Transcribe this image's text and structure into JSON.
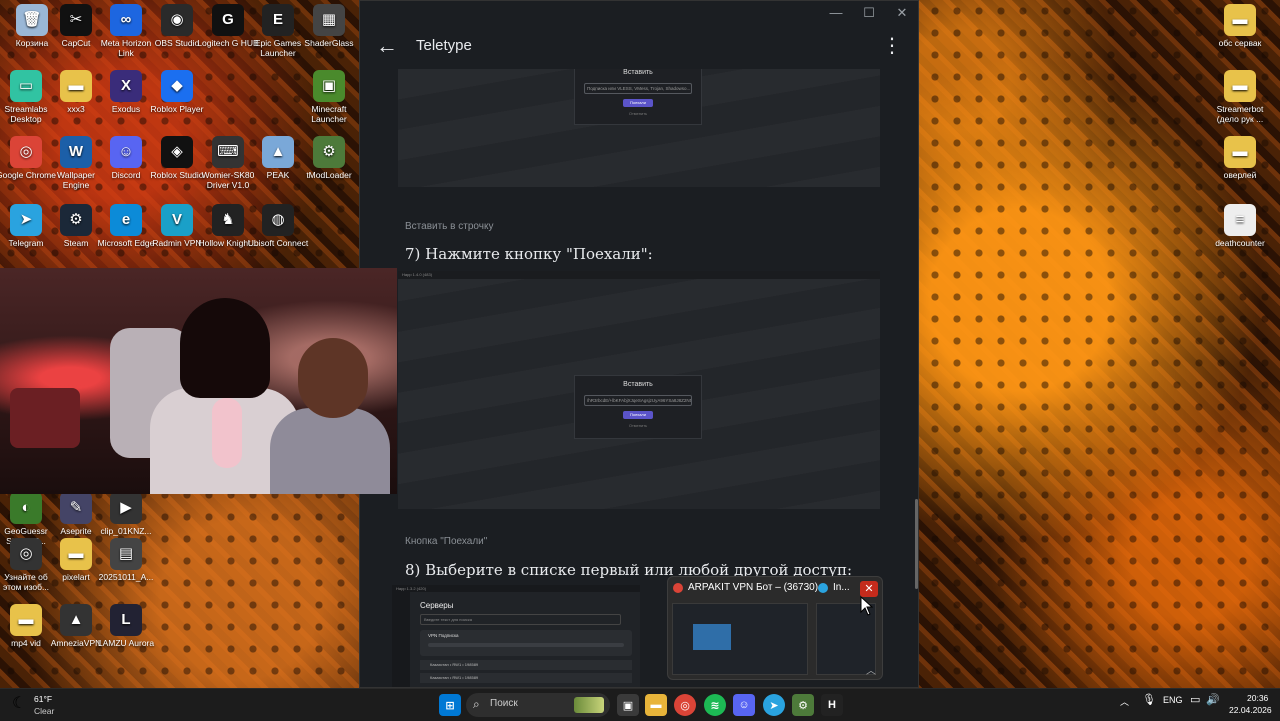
{
  "desktop_icons": [
    {
      "label": "Корзина",
      "icon": "recycle-bin-icon",
      "color": "#9ab7d6",
      "glyph": "🗑"
    },
    {
      "label": "CapCut",
      "icon": "capcut-icon",
      "color": "#111111",
      "glyph": "✂"
    },
    {
      "label": "Meta Horizon Link",
      "icon": "meta-horizon-icon",
      "color": "#1d66e0",
      "glyph": "∞"
    },
    {
      "label": "OBS Studio",
      "icon": "obs-icon",
      "color": "#2a2a2a",
      "glyph": "◉"
    },
    {
      "label": "Logitech G HUB",
      "icon": "logitech-icon",
      "color": "#111111",
      "glyph": "G"
    },
    {
      "label": "Epic Games Launcher",
      "icon": "epic-games-icon",
      "color": "#222222",
      "glyph": "E"
    },
    {
      "label": "ShaderGlass",
      "icon": "shaderglass-icon",
      "color": "#444444",
      "glyph": "▦"
    },
    {
      "label": "Streamlabs Desktop",
      "icon": "streamlabs-icon",
      "color": "#31c3a2",
      "glyph": "▭"
    },
    {
      "label": "xxx3",
      "icon": "folder-icon",
      "color": "#e8c24a",
      "glyph": "▬"
    },
    {
      "label": "Exodus",
      "icon": "exodus-icon",
      "color": "#3a2c7a",
      "glyph": "X"
    },
    {
      "label": "Roblox Player",
      "icon": "roblox-icon",
      "color": "#1b6ff0",
      "glyph": "◆"
    },
    {
      "label": "Minecraft Launcher",
      "icon": "minecraft-icon",
      "color": "#4a8a2c",
      "glyph": "▣"
    },
    {
      "label": "Google Chrome",
      "icon": "chrome-icon",
      "color": "#db4437",
      "glyph": "◎"
    },
    {
      "label": "Wallpaper Engine",
      "icon": "wallpaper-engine-icon",
      "color": "#1c5fa8",
      "glyph": "W"
    },
    {
      "label": "Discord",
      "icon": "discord-icon",
      "color": "#5865f2",
      "glyph": "☺"
    },
    {
      "label": "Roblox Studio",
      "icon": "roblox-studio-icon",
      "color": "#111111",
      "glyph": "◈"
    },
    {
      "label": "Womier-SK80 Driver V1.0",
      "icon": "womier-icon",
      "color": "#333333",
      "glyph": "⌨"
    },
    {
      "label": "PEAK",
      "icon": "peak-icon",
      "color": "#7aa8d8",
      "glyph": "▲"
    },
    {
      "label": "tModLoader",
      "icon": "tmodloader-icon",
      "color": "#4d7a3a",
      "glyph": "⚙"
    },
    {
      "label": "Telegram",
      "icon": "telegram-icon",
      "color": "#2aa3df",
      "glyph": "➤"
    },
    {
      "label": "Steam",
      "icon": "steam-icon",
      "color": "#1b2838",
      "glyph": "⚙"
    },
    {
      "label": "Microsoft Edge",
      "icon": "edge-icon",
      "color": "#0c8bd8",
      "glyph": "e"
    },
    {
      "label": "Radmin VPN",
      "icon": "radmin-vpn-icon",
      "color": "#1aa0c8",
      "glyph": "V"
    },
    {
      "label": "Hollow Knight...",
      "icon": "hollow-knight-icon",
      "color": "#222222",
      "glyph": "♞"
    },
    {
      "label": "Ubisoft Connect",
      "icon": "ubisoft-icon",
      "color": "#222222",
      "glyph": "◍"
    },
    {
      "label": "GeoGuessr Steam E...",
      "icon": "geoguessr-icon",
      "color": "#3a7a2a",
      "glyph": "◐"
    },
    {
      "label": "Aseprite",
      "icon": "aseprite-icon",
      "color": "#444466",
      "glyph": "✎"
    },
    {
      "label": "clip_01KNZ...",
      "icon": "video-file-icon",
      "color": "#333333",
      "glyph": "▶"
    },
    {
      "label": "Узнайте об этом изоб...",
      "icon": "spotlight-icon",
      "color": "#333333",
      "glyph": "◎"
    },
    {
      "label": "pixelart",
      "icon": "folder-icon",
      "color": "#e8c24a",
      "glyph": "▬"
    },
    {
      "label": "20251011_A...",
      "icon": "image-file-icon",
      "color": "#444444",
      "glyph": "▤"
    },
    {
      "label": "mp4 vid",
      "icon": "folder-icon",
      "color": "#e8c24a",
      "glyph": "▬"
    },
    {
      "label": "AmneziaVPN",
      "icon": "amnezia-vpn-icon",
      "color": "#333333",
      "glyph": "▲"
    },
    {
      "label": "LAMZU Aurora",
      "icon": "lamzu-icon",
      "color": "#222233",
      "glyph": "L"
    },
    {
      "label": "обс сервак",
      "icon": "folder-icon",
      "color": "#e8c24a",
      "glyph": "▬"
    },
    {
      "label": "Streamerbot (дело рук ...",
      "icon": "folder-icon",
      "color": "#e8c24a",
      "glyph": "▬"
    },
    {
      "label": "оверлей",
      "icon": "folder-icon",
      "color": "#e8c24a",
      "glyph": "▬"
    },
    {
      "label": "deathcounter",
      "icon": "text-file-icon",
      "color": "#eeeeee",
      "glyph": "≡"
    }
  ],
  "window": {
    "app_title": "Teletype",
    "minimize": "—",
    "maximize": "☐",
    "close": "✕",
    "back": "←",
    "menu": "⋮"
  },
  "article": {
    "dialog1_title": "Вставить",
    "dialog1_field": "Подписка или VLESS, VMess, Trojan, Shadowso...",
    "dialog1_button": "Поехали",
    "dialog1_cancel": "Отменить",
    "caption1": "Вставить в строчку",
    "step7": "7) Нажмите кнопку \"Поехали\":",
    "shot2_header": "Happ 1.4.0 (483)",
    "dialog2_title": "Вставить",
    "dialog2_field": "/hR3rbcdE/+lbKFAbjXJqeSAgsjzUyA96YSa8J8Z2N5X4",
    "dialog2_button": "Поехали",
    "dialog2_cancel": "Отменить",
    "caption2": "Кнопка \"Поехали\"",
    "step8": "8) Выберите в списке первый или любой другой доступ:",
    "shot3_header": "Happ 1.3.2 (420)",
    "shot3_title": "Серверы",
    "shot3_search": "Введите текст для поиска",
    "shot3_group": "VPN Подписка",
    "shot3_row1": "Казахстан • RW1 • 198589",
    "shot3_row2": "Казахстан • RW1 • 198589"
  },
  "preview": {
    "tab1": "ARPAKIT VPN Бот – (36730)",
    "tab2": "In...",
    "close": "✕",
    "scroll_up": "︿"
  },
  "taskbar": {
    "weather_temp": "61°F",
    "weather_desc": "Clear",
    "search_label": "Поиск",
    "language": "ENG",
    "time": "20:36",
    "date": "22.04.2026",
    "chevron": "︿"
  }
}
